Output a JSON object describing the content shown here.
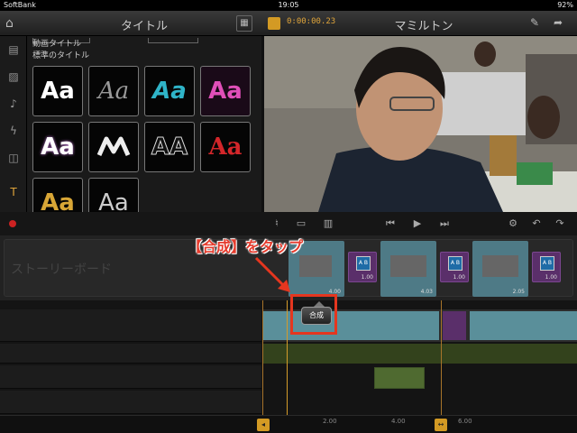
{
  "status": {
    "carrier": "SoftBank",
    "time": "19:05",
    "battery": "92%"
  },
  "topbar": {
    "panel_title": "タイトル",
    "timecode": "0:00:00.23",
    "project_title": "マミルトン"
  },
  "titles": {
    "section_motion": "動画タイトル",
    "section_standard": "標準のタイトル",
    "sample_text": "Aa"
  },
  "storyboard": {
    "label": "ストーリーボード",
    "clips": [
      {
        "duration": "4.00"
      },
      {
        "duration": "4.03"
      },
      {
        "duration": "2.05"
      }
    ],
    "transitions": [
      {
        "label": "A B",
        "duration": "1.00"
      },
      {
        "label": "A B",
        "duration": "1.00"
      },
      {
        "label": "A B",
        "duration": "1.00"
      }
    ]
  },
  "annotation": {
    "text": "【合成】をタップ",
    "button_label": "合成"
  },
  "ruler": {
    "ticks": [
      "2.00",
      "4.00",
      "6.00"
    ]
  },
  "colors": {
    "accent": "#d39a24",
    "annotation": "#e5361f",
    "clip": "#4e7a86",
    "transition": "#5a2f6a"
  }
}
